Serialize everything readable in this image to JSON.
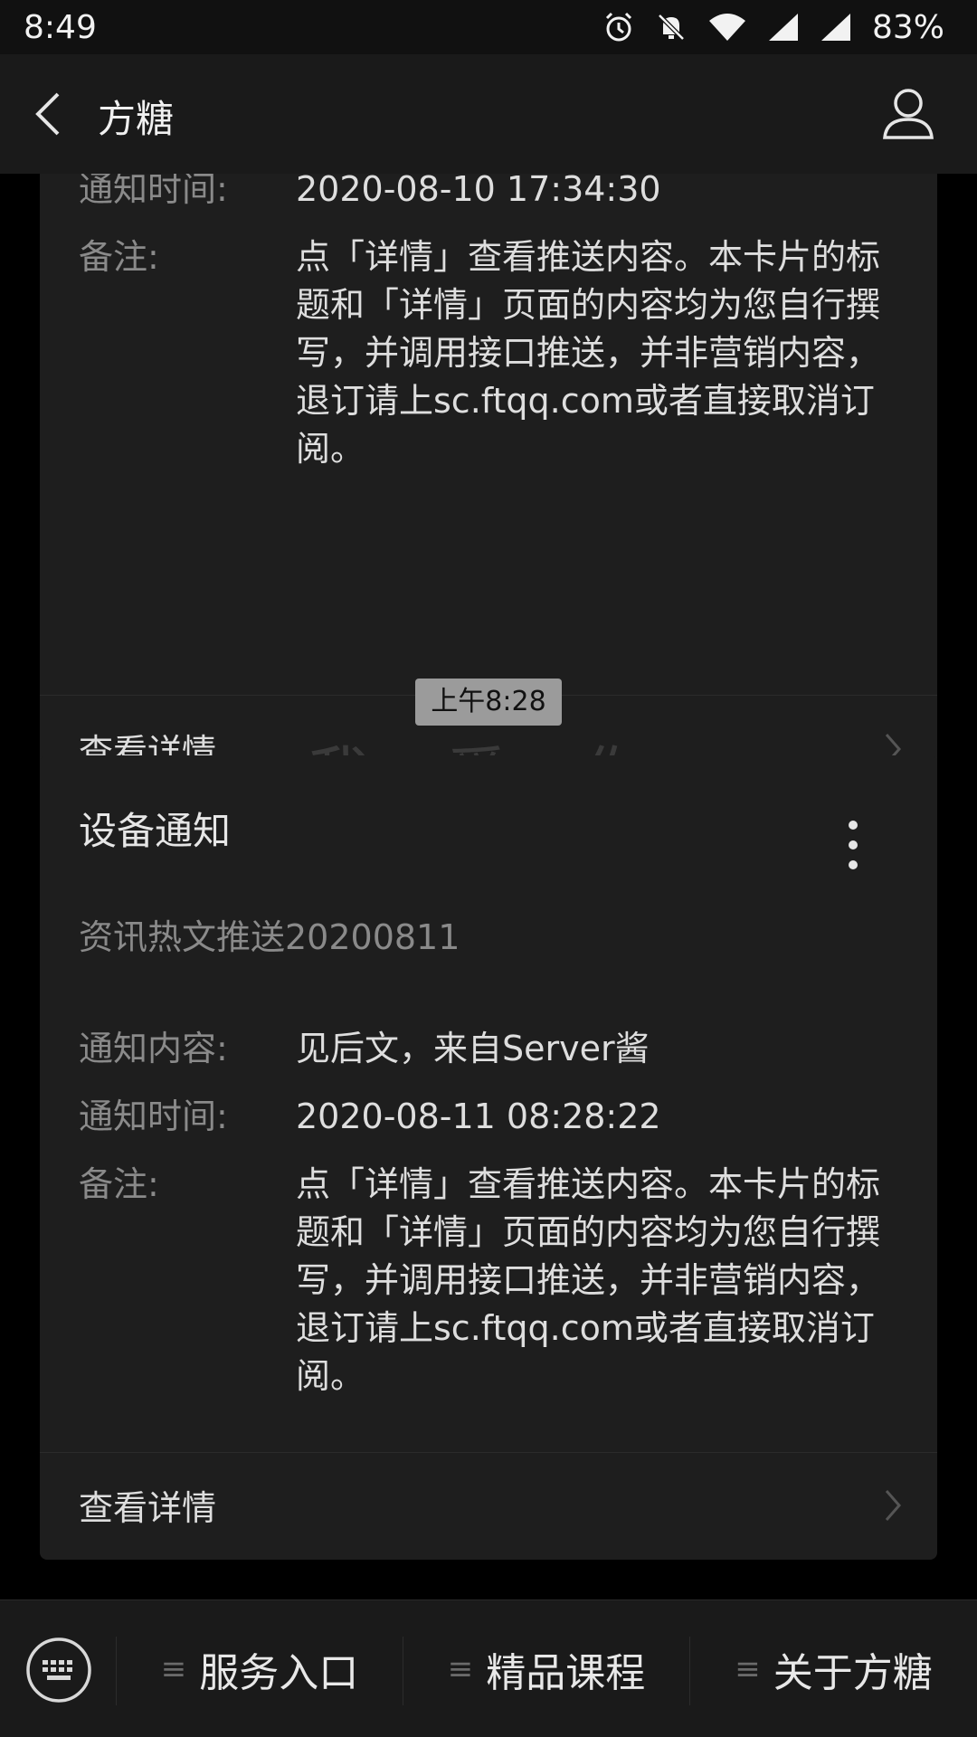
{
  "status_bar": {
    "time": "8:49",
    "battery": "83%",
    "icons": [
      "alarm-icon",
      "bell-off-icon",
      "wifi-icon",
      "signal-icon",
      "signal-icon"
    ]
  },
  "nav": {
    "title": "方糖",
    "back_icon": "chevron-left-icon",
    "user_icon": "user-icon"
  },
  "cards": [
    {
      "rows": [
        {
          "label": "通知时间:",
          "value": "2020-08-10 17:34:30"
        },
        {
          "label": "备注:",
          "value": "点「详情」查看推送内容。本卡片的标题和「详情」页面的内容均为您自行撰写，并调用接口推送，并非营销内容，退订请上sc.ftqq.com或者直接取消订阅。"
        }
      ],
      "detail_label": "查看详情"
    },
    {
      "title": "设备通知",
      "subtitle": "资讯热文推送20200811",
      "rows": [
        {
          "label": "通知内容:",
          "value": "见后文，来自Server酱"
        },
        {
          "label": "通知时间:",
          "value": "2020-08-11 08:28:22"
        },
        {
          "label": "备注:",
          "value": "点「详情」查看推送内容。本卡片的标题和「详情」页面的内容均为您自行撰写，并调用接口推送，并非营销内容，退订请上sc.ftqq.com或者直接取消订阅。"
        }
      ],
      "detail_label": "查看详情"
    }
  ],
  "timestamp": "上午8:28",
  "ghost_text": "我 爱 你",
  "bottom_menu": {
    "items": [
      "服务入口",
      "精品课程",
      "关于方糖"
    ]
  }
}
